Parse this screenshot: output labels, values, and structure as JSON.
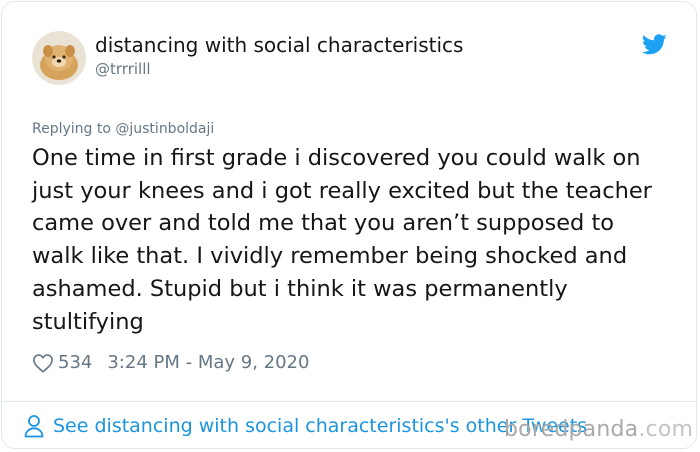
{
  "tweet": {
    "display_name": "distancing with social characteristics",
    "handle": "@trrrilll",
    "replying_to": "Replying to @justinboldaji",
    "text": "One time in first grade i discovered you could walk on just your knees and i got really excited but the teacher came over and told me that you aren’t supposed to walk like that. I vividly remember being shocked and ashamed. Stupid but i think it was permanently stultifying",
    "likes": "534",
    "timestamp": "3:24 PM - May 9, 2020",
    "footer_link": "See distancing with social characteristics's other Tweets"
  },
  "icons": {
    "logo": "twitter-bird-icon",
    "like": "heart-icon",
    "footer": "person-icon"
  },
  "watermark": {
    "brand": "boredpanda",
    "suffix": ".com"
  },
  "colors": {
    "twitter_blue": "#1da1f2",
    "link_blue": "#1b95e0",
    "text": "#14171a",
    "muted": "#657786",
    "border": "#e1e8ed"
  }
}
